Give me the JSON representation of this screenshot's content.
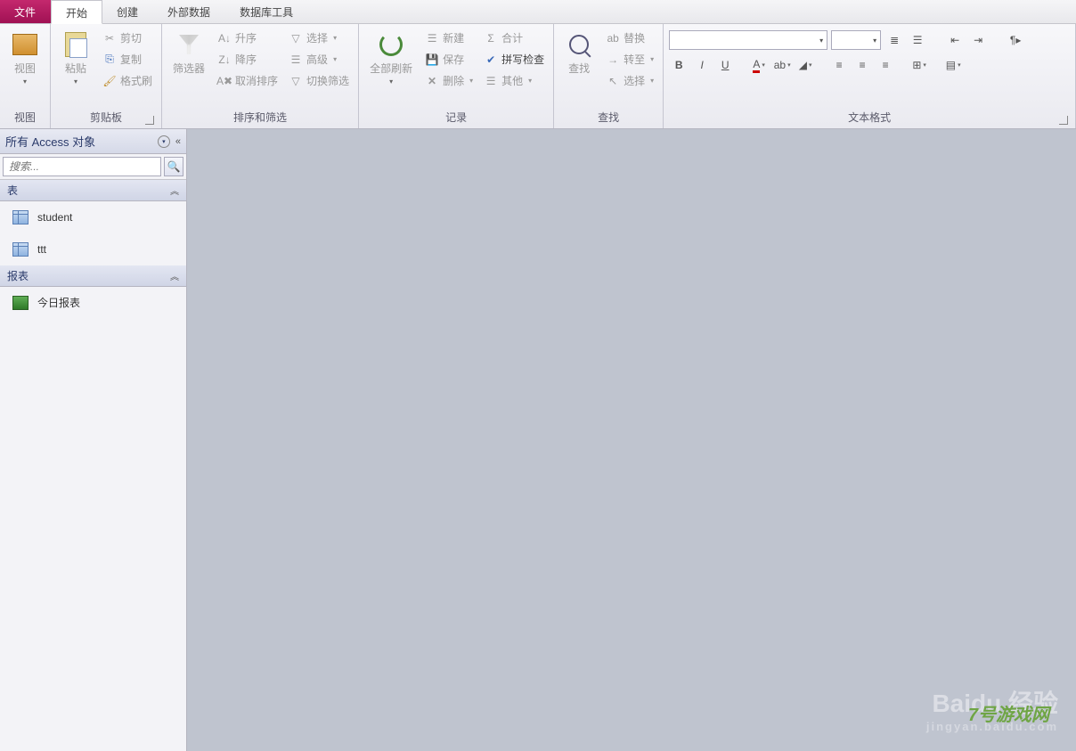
{
  "tabs": {
    "file": "文件",
    "home": "开始",
    "create": "创建",
    "external": "外部数据",
    "dbtools": "数据库工具"
  },
  "ribbon": {
    "view": {
      "label": "视图",
      "group": "视图"
    },
    "clipboard": {
      "paste": "粘贴",
      "cut": "剪切",
      "copy": "复制",
      "formatpainter": "格式刷",
      "group": "剪贴板"
    },
    "sortfilter": {
      "filter": "筛选器",
      "asc": "升序",
      "desc": "降序",
      "clearsort": "取消排序",
      "selection": "选择",
      "advanced": "高级",
      "toggle": "切换筛选",
      "group": "排序和筛选"
    },
    "records": {
      "refreshall": "全部刷新",
      "new": "新建",
      "save": "保存",
      "delete": "删除",
      "totals": "合计",
      "spelling": "拼写检查",
      "more": "其他",
      "group": "记录"
    },
    "find": {
      "find": "查找",
      "replace": "替换",
      "goto": "转至",
      "select": "选择",
      "group": "查找"
    },
    "textformat": {
      "group": "文本格式"
    }
  },
  "nav": {
    "title": "所有 Access 对象",
    "search_placeholder": "搜索...",
    "cat_tables": "表",
    "cat_reports": "报表",
    "items": {
      "student": "student",
      "ttt": "ttt",
      "today_report": "今日报表"
    }
  },
  "watermark": {
    "brand": "Baidu 经验",
    "sub": "jingyan.baidu.com",
    "game": "7号游戏网"
  }
}
